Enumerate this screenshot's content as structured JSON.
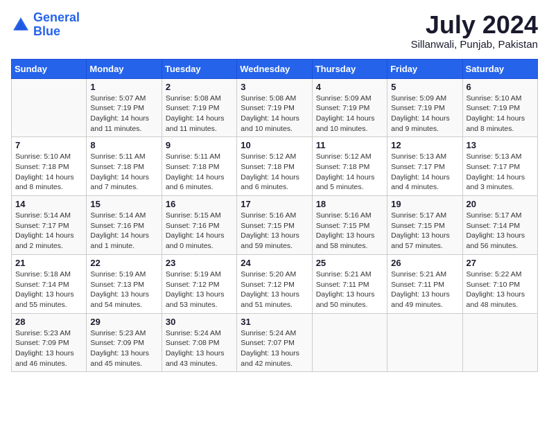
{
  "header": {
    "logo_line1": "General",
    "logo_line2": "Blue",
    "month_title": "July 2024",
    "location": "Sillanwali, Punjab, Pakistan"
  },
  "days_of_week": [
    "Sunday",
    "Monday",
    "Tuesday",
    "Wednesday",
    "Thursday",
    "Friday",
    "Saturday"
  ],
  "weeks": [
    [
      {
        "day": "",
        "info": ""
      },
      {
        "day": "1",
        "info": "Sunrise: 5:07 AM\nSunset: 7:19 PM\nDaylight: 14 hours\nand 11 minutes."
      },
      {
        "day": "2",
        "info": "Sunrise: 5:08 AM\nSunset: 7:19 PM\nDaylight: 14 hours\nand 11 minutes."
      },
      {
        "day": "3",
        "info": "Sunrise: 5:08 AM\nSunset: 7:19 PM\nDaylight: 14 hours\nand 10 minutes."
      },
      {
        "day": "4",
        "info": "Sunrise: 5:09 AM\nSunset: 7:19 PM\nDaylight: 14 hours\nand 10 minutes."
      },
      {
        "day": "5",
        "info": "Sunrise: 5:09 AM\nSunset: 7:19 PM\nDaylight: 14 hours\nand 9 minutes."
      },
      {
        "day": "6",
        "info": "Sunrise: 5:10 AM\nSunset: 7:19 PM\nDaylight: 14 hours\nand 8 minutes."
      }
    ],
    [
      {
        "day": "7",
        "info": "Sunrise: 5:10 AM\nSunset: 7:18 PM\nDaylight: 14 hours\nand 8 minutes."
      },
      {
        "day": "8",
        "info": "Sunrise: 5:11 AM\nSunset: 7:18 PM\nDaylight: 14 hours\nand 7 minutes."
      },
      {
        "day": "9",
        "info": "Sunrise: 5:11 AM\nSunset: 7:18 PM\nDaylight: 14 hours\nand 6 minutes."
      },
      {
        "day": "10",
        "info": "Sunrise: 5:12 AM\nSunset: 7:18 PM\nDaylight: 14 hours\nand 6 minutes."
      },
      {
        "day": "11",
        "info": "Sunrise: 5:12 AM\nSunset: 7:18 PM\nDaylight: 14 hours\nand 5 minutes."
      },
      {
        "day": "12",
        "info": "Sunrise: 5:13 AM\nSunset: 7:17 PM\nDaylight: 14 hours\nand 4 minutes."
      },
      {
        "day": "13",
        "info": "Sunrise: 5:13 AM\nSunset: 7:17 PM\nDaylight: 14 hours\nand 3 minutes."
      }
    ],
    [
      {
        "day": "14",
        "info": "Sunrise: 5:14 AM\nSunset: 7:17 PM\nDaylight: 14 hours\nand 2 minutes."
      },
      {
        "day": "15",
        "info": "Sunrise: 5:14 AM\nSunset: 7:16 PM\nDaylight: 14 hours\nand 1 minute."
      },
      {
        "day": "16",
        "info": "Sunrise: 5:15 AM\nSunset: 7:16 PM\nDaylight: 14 hours\nand 0 minutes."
      },
      {
        "day": "17",
        "info": "Sunrise: 5:16 AM\nSunset: 7:15 PM\nDaylight: 13 hours\nand 59 minutes."
      },
      {
        "day": "18",
        "info": "Sunrise: 5:16 AM\nSunset: 7:15 PM\nDaylight: 13 hours\nand 58 minutes."
      },
      {
        "day": "19",
        "info": "Sunrise: 5:17 AM\nSunset: 7:15 PM\nDaylight: 13 hours\nand 57 minutes."
      },
      {
        "day": "20",
        "info": "Sunrise: 5:17 AM\nSunset: 7:14 PM\nDaylight: 13 hours\nand 56 minutes."
      }
    ],
    [
      {
        "day": "21",
        "info": "Sunrise: 5:18 AM\nSunset: 7:14 PM\nDaylight: 13 hours\nand 55 minutes."
      },
      {
        "day": "22",
        "info": "Sunrise: 5:19 AM\nSunset: 7:13 PM\nDaylight: 13 hours\nand 54 minutes."
      },
      {
        "day": "23",
        "info": "Sunrise: 5:19 AM\nSunset: 7:12 PM\nDaylight: 13 hours\nand 53 minutes."
      },
      {
        "day": "24",
        "info": "Sunrise: 5:20 AM\nSunset: 7:12 PM\nDaylight: 13 hours\nand 51 minutes."
      },
      {
        "day": "25",
        "info": "Sunrise: 5:21 AM\nSunset: 7:11 PM\nDaylight: 13 hours\nand 50 minutes."
      },
      {
        "day": "26",
        "info": "Sunrise: 5:21 AM\nSunset: 7:11 PM\nDaylight: 13 hours\nand 49 minutes."
      },
      {
        "day": "27",
        "info": "Sunrise: 5:22 AM\nSunset: 7:10 PM\nDaylight: 13 hours\nand 48 minutes."
      }
    ],
    [
      {
        "day": "28",
        "info": "Sunrise: 5:23 AM\nSunset: 7:09 PM\nDaylight: 13 hours\nand 46 minutes."
      },
      {
        "day": "29",
        "info": "Sunrise: 5:23 AM\nSunset: 7:09 PM\nDaylight: 13 hours\nand 45 minutes."
      },
      {
        "day": "30",
        "info": "Sunrise: 5:24 AM\nSunset: 7:08 PM\nDaylight: 13 hours\nand 43 minutes."
      },
      {
        "day": "31",
        "info": "Sunrise: 5:24 AM\nSunset: 7:07 PM\nDaylight: 13 hours\nand 42 minutes."
      },
      {
        "day": "",
        "info": ""
      },
      {
        "day": "",
        "info": ""
      },
      {
        "day": "",
        "info": ""
      }
    ]
  ]
}
